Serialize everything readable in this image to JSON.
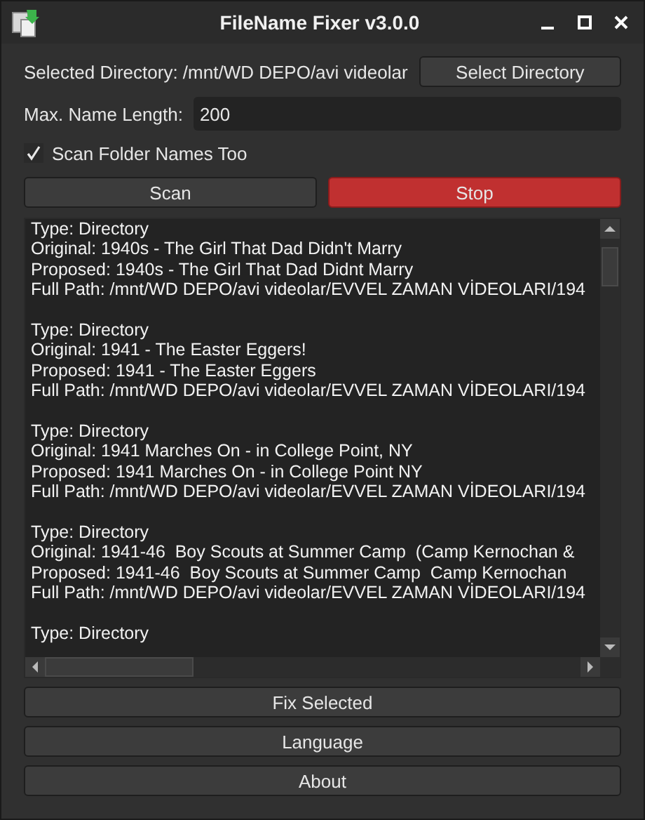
{
  "window": {
    "title": "FileName Fixer v3.0.0"
  },
  "directory": {
    "label": "Selected Directory: /mnt/WD DEPO/avi videolar",
    "button": "Select Directory"
  },
  "max_length": {
    "label": "Max. Name Length:",
    "value": "200"
  },
  "scan_folders": {
    "label": "Scan Folder Names Too",
    "checked": true
  },
  "actions": [
    {
      "label": "Scan",
      "kind": "normal"
    },
    {
      "label": "Stop",
      "kind": "danger"
    }
  ],
  "log": [
    {
      "lines": [
        "Type: Directory",
        "Original: 1940s - The Girl That Dad Didn't Marry",
        "Proposed: 1940s - The Girl That Dad Didnt Marry",
        "Full Path: /mnt/WD DEPO/avi videolar/EVVEL ZAMAN VİDEOLARI/194"
      ]
    },
    {
      "lines": [
        "Type: Directory",
        "Original: 1941 - The Easter Eggers!",
        "Proposed: 1941 - The Easter Eggers",
        "Full Path: /mnt/WD DEPO/avi videolar/EVVEL ZAMAN VİDEOLARI/194"
      ]
    },
    {
      "lines": [
        "Type: Directory",
        "Original: 1941 Marches On - in College Point, NY",
        "Proposed: 1941 Marches On - in College Point NY",
        "Full Path: /mnt/WD DEPO/avi videolar/EVVEL ZAMAN VİDEOLARI/194"
      ]
    },
    {
      "lines": [
        "Type: Directory",
        "Original: 1941-46  Boy Scouts at Summer Camp  (Camp Kernochan &",
        "Proposed: 1941-46  Boy Scouts at Summer Camp  Camp Kernochan",
        "Full Path: /mnt/WD DEPO/avi videolar/EVVEL ZAMAN VİDEOLARI/194"
      ]
    },
    {
      "lines": [
        "Type: Directory"
      ]
    }
  ],
  "bottom_buttons": [
    "Fix Selected",
    "Language",
    "About"
  ]
}
